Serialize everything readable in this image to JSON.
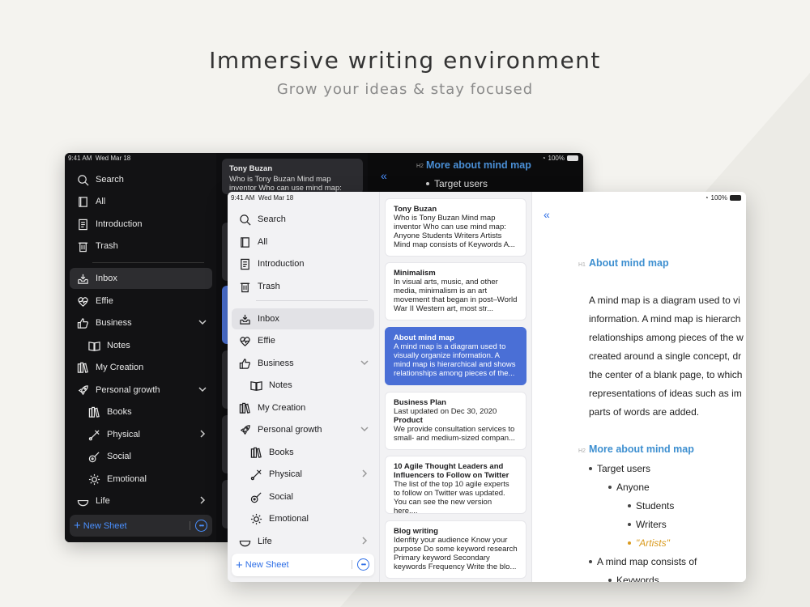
{
  "hero": {
    "title": "Immersive writing environment",
    "subtitle": "Grow your ideas & stay focused"
  },
  "status": {
    "time": "9:41 AM",
    "date": "Wed Mar 18",
    "battery": "100%"
  },
  "sidebar": {
    "search": "Search",
    "all": "All",
    "introduction": "Introduction",
    "trash": "Trash",
    "inbox": "Inbox",
    "effie": "Effie",
    "business": "Business",
    "notes": "Notes",
    "my_creation": "My Creation",
    "personal_growth": "Personal growth",
    "books": "Books",
    "physical": "Physical",
    "social": "Social",
    "emotional": "Emotional",
    "life": "Life",
    "new_sheet": "New Sheet"
  },
  "dark_card": {
    "title": "Tony Buzan",
    "preview": "Who is Tony Buzan Mind map inventor Who can use mind map:"
  },
  "dark_editor": {
    "h2_tag": "H2",
    "heading": "More about mind map",
    "bullet": "Target users"
  },
  "cards": [
    {
      "title": "Tony Buzan",
      "preview": "Who is Tony Buzan Mind map inventor Who can use mind map: Anyone Students Writers Artists Mind map consists of Keywords A..."
    },
    {
      "title": "Minimalism",
      "preview": "In visual arts, music, and other media, minimalism is an art movement that began in post–World War II Western art, most str..."
    },
    {
      "title": "About mind map",
      "preview": "A mind map is a diagram used to visually organize information. A mind map is hierarchical and shows relationships among pieces of the..."
    },
    {
      "title": "Business Plan",
      "preview": "Last updated on Dec 30, 2020",
      "subtitle": "Product",
      "preview2": "We provide consultation services to small- and medium-sized compan..."
    },
    {
      "title": "10 Agile Thought Leaders and Influencers to Follow on Twitter",
      "preview": "The list of the top 10 agile experts to follow on Twitter was updated. You can see the new version here...."
    },
    {
      "title": "Blog writing",
      "preview": "Idenfity your audience Know your purpose Do some keyword research Primary keyword Secondary keywords Frequency Write the blo..."
    }
  ],
  "editor": {
    "h1_tag": "H1",
    "h1": "About mind map",
    "para": [
      "A mind map is a diagram used to vi",
      "information. A mind map is hierarch",
      "relationships among pieces of the w",
      "created around a single concept, dr",
      "the center of a blank page, to which",
      "representations of ideas such as im",
      "parts of words are added."
    ],
    "h2_tag": "H2",
    "h2": "More about mind map",
    "bullets": {
      "target_users": "Target users",
      "anyone": "Anyone",
      "students": "Students",
      "writers": "Writers",
      "artists": "\"Artists\"",
      "consists": "A mind map consists of",
      "keywords": "Keywords"
    }
  },
  "colors": {
    "accent": "#2f6fe6",
    "selected_card": "#4a6fd6",
    "heading": "#3d8fd0",
    "highlight": "#d99a1e"
  }
}
